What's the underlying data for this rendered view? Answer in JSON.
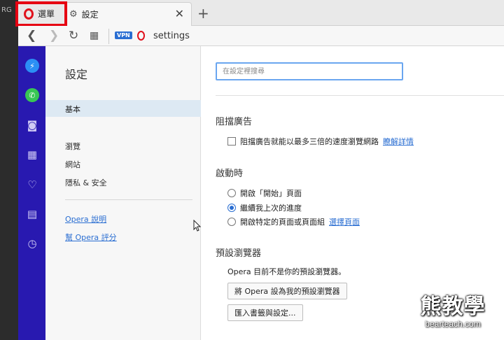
{
  "background_left": {
    "label": "RG"
  },
  "tabbar": {
    "menu_label": "選單",
    "settings_tab_label": "設定",
    "close_glyph": "✕",
    "new_tab_glyph": "+"
  },
  "addressbar": {
    "vpn_badge": "VPN",
    "url": "settings"
  },
  "nav_panel": {
    "title": "設定",
    "active_item": "基本",
    "items": [
      "瀏覽",
      "網站",
      "隱私 & 安全"
    ],
    "links": [
      "Opera 說明",
      "幫 Opera 評分"
    ]
  },
  "main": {
    "search_placeholder": "在設定裡搜尋",
    "adblock": {
      "title": "阻擋廣告",
      "checkbox_label": "阻擋廣告就能以最多三倍的速度瀏覽網路",
      "learn_more": "瞭解詳情"
    },
    "startup": {
      "title": "啟動時",
      "options": [
        {
          "label": "開啟「開始」頁面",
          "checked": false
        },
        {
          "label": "繼續我上次的進度",
          "checked": true
        },
        {
          "label": "開啟特定的頁面或頁面組",
          "checked": false
        }
      ],
      "set_pages_link": "選擇頁面"
    },
    "default_browser": {
      "title": "預設瀏覽器",
      "status": "Opera 目前不是你的預設瀏覽器。",
      "set_default_button": "將 Opera 設為我的預設瀏覽器",
      "import_button": "匯入書籤與設定..."
    }
  },
  "watermark": {
    "main": "熊教學",
    "sub": "bearteach.com"
  },
  "colors": {
    "sidebar": "#2819b0",
    "accent": "#2a6ed2",
    "opera_red": "#e0121c",
    "highlight": "#e60012"
  }
}
